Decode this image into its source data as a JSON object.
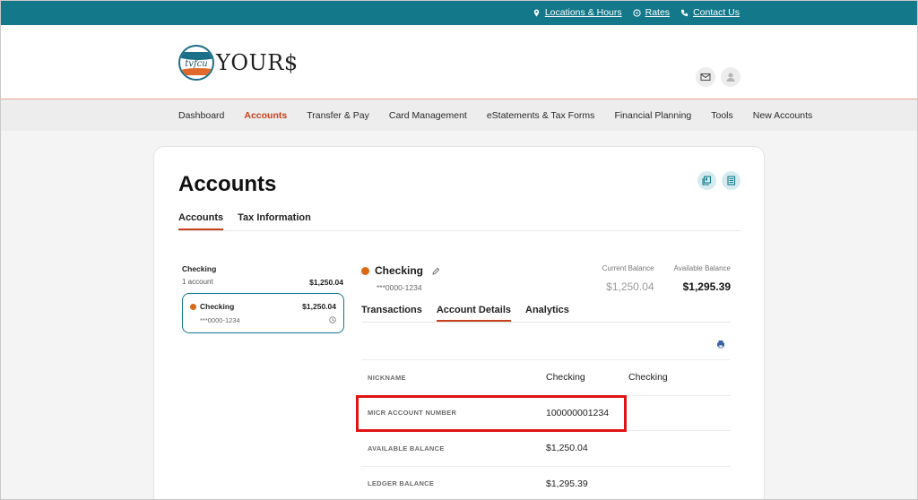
{
  "utility": {
    "locations": "Locations & Hours",
    "rates": "Rates",
    "contact": "Contact Us"
  },
  "header": {
    "logo_circle_text": "tvfcu",
    "logo_word": "YOUR$"
  },
  "nav": [
    "Dashboard",
    "Accounts",
    "Transfer & Pay",
    "Card Management",
    "eStatements & Tax Forms",
    "Financial Planning",
    "Tools",
    "New Accounts"
  ],
  "nav_active": "Accounts",
  "page": {
    "title": "Accounts",
    "tabs": [
      "Accounts",
      "Tax Information"
    ]
  },
  "account_group": {
    "name": "Checking",
    "count": "1 account",
    "total": "$1,250.04"
  },
  "account_tile": {
    "name": "Checking",
    "balance": "$1,250.04",
    "mask": "***0000-1234"
  },
  "detail": {
    "name": "Checking",
    "mask": "***0000-1234",
    "current_balance_label": "Current Balance",
    "current_balance": "$1,250.04",
    "available_balance_label": "Available Balance",
    "available_balance": "$1,295.39",
    "tabs": [
      "Transactions",
      "Account Details",
      "Analytics"
    ],
    "rows": [
      {
        "key": "NICKNAME",
        "value": "Checking",
        "value2": "Checking"
      },
      {
        "key": "MICR ACCOUNT NUMBER",
        "value": "100000001234",
        "value2": ""
      },
      {
        "key": "AVAILABLE BALANCE",
        "value": "$1,250.04",
        "value2": ""
      },
      {
        "key": "LEDGER BALANCE",
        "value": "$1,295.39",
        "value2": ""
      }
    ]
  },
  "colors": {
    "brand_teal": "#12788a",
    "accent_orange": "#c8401e",
    "highlight_red": "#e01414"
  }
}
